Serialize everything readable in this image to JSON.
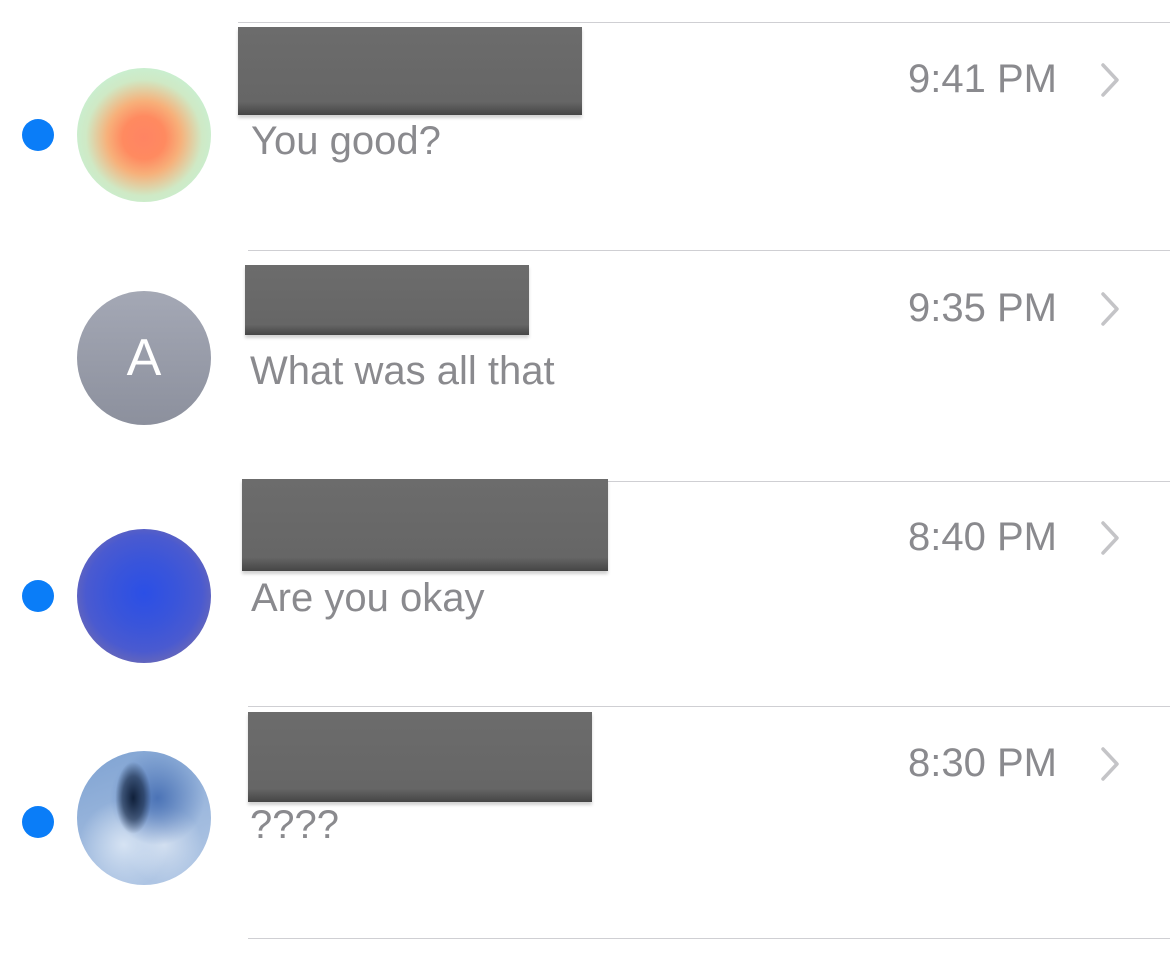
{
  "conversations": [
    {
      "unread": true,
      "avatar": "gradient-orange-green-avatar",
      "avatar_initial": "",
      "contact_name": "",
      "preview": "You good?",
      "time": "9:41 PM"
    },
    {
      "unread": false,
      "avatar": "initial-avatar",
      "avatar_initial": "A",
      "contact_name": "",
      "preview": "What was all that",
      "time": "9:35 PM"
    },
    {
      "unread": true,
      "avatar": "gradient-blue-yellow-avatar",
      "avatar_initial": "",
      "contact_name": "",
      "preview": "Are you okay",
      "time": "8:40 PM"
    },
    {
      "unread": true,
      "avatar": "blurred-photo-avatar",
      "avatar_initial": "",
      "contact_name": "",
      "preview": "????",
      "time": "8:30 PM"
    }
  ],
  "icons": {
    "unread": "unread-dot-icon",
    "disclosure": "chevron-right-icon"
  },
  "colors": {
    "unread_dot": "#0a7df8",
    "secondary_text": "#8a8a8e",
    "separator": "#cfcfd3",
    "redaction": "#666666"
  }
}
